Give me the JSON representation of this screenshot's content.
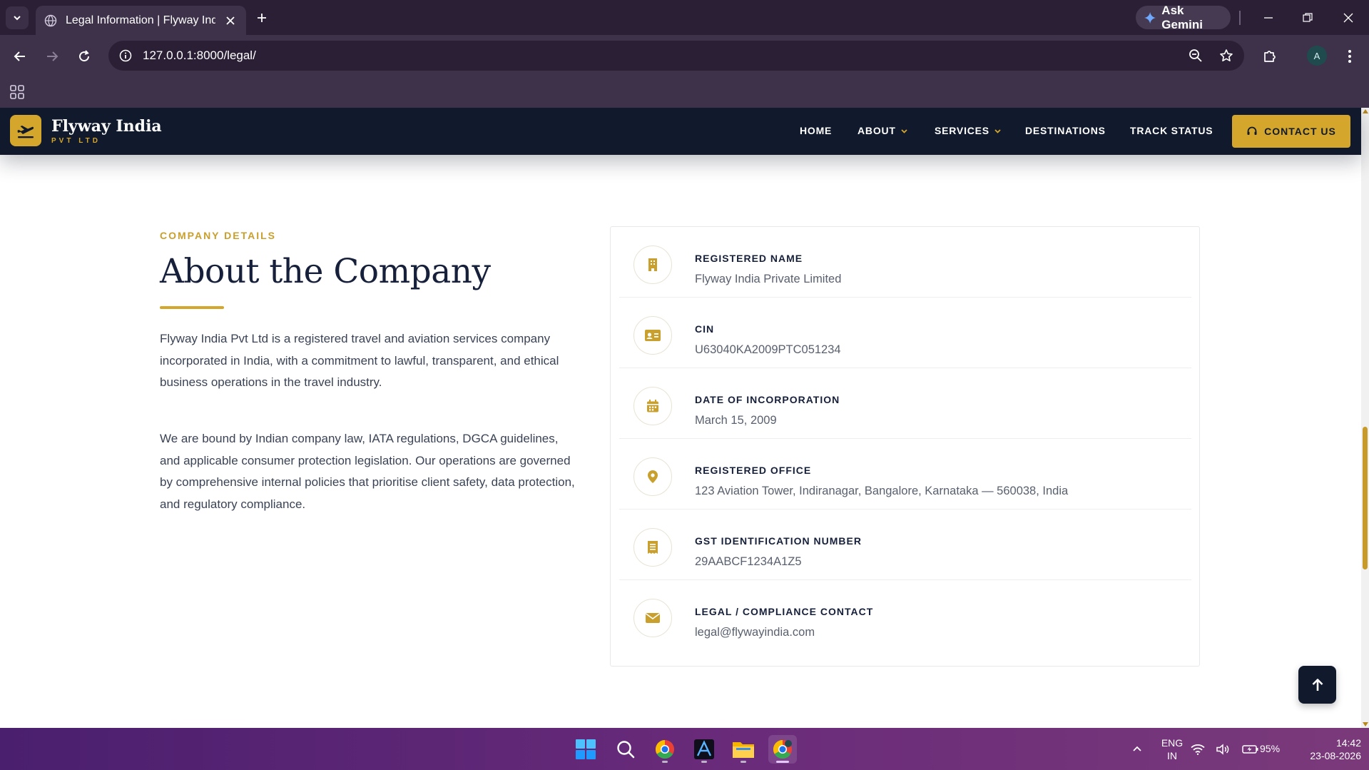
{
  "browser": {
    "tab_title": "Legal Information | Flyway India",
    "new_tab_label": "+",
    "gemini_label": "Ask Gemini",
    "url": "127.0.0.1:8000/legal/",
    "profile_initial": "A"
  },
  "site": {
    "logo_name": "Flyway India",
    "logo_sub": "PVT LTD",
    "nav": {
      "home": "HOME",
      "about": "ABOUT",
      "services": "SERVICES",
      "destinations": "DESTINATIONS",
      "track_status": "TRACK STATUS"
    },
    "contact_label": "CONTACT US"
  },
  "section": {
    "kicker": "COMPANY DETAILS",
    "heading": "About the Company",
    "paragraphs": [
      "Flyway India Pvt Ltd is a registered travel and aviation services company incorporated in India, with a commitment to lawful, transparent, and ethical business operations in the travel industry.",
      "We are bound by Indian company law, IATA regulations, DGCA guidelines, and applicable consumer protection legislation. Our operations are governed by comprehensive internal policies that prioritise client safety, data protection, and regulatory compliance."
    ]
  },
  "details": [
    {
      "icon": "building-icon",
      "label": "REGISTERED NAME",
      "value": "Flyway India Private Limited"
    },
    {
      "icon": "id-card-icon",
      "label": "CIN",
      "value": "U63040KA2009PTC051234"
    },
    {
      "icon": "calendar-icon",
      "label": "DATE OF INCORPORATION",
      "value": "March 15, 2009"
    },
    {
      "icon": "map-pin-icon",
      "label": "REGISTERED OFFICE",
      "value": "123 Aviation Tower, Indiranagar, Bangalore, Karnataka — 560038, India"
    },
    {
      "icon": "receipt-icon",
      "label": "GST IDENTIFICATION NUMBER",
      "value": "29AABCF1234A1Z5"
    },
    {
      "icon": "envelope-icon",
      "label": "LEGAL / COMPLIANCE CONTACT",
      "value": "legal@flywayindia.com"
    }
  ],
  "taskbar": {
    "lang_top": "ENG",
    "lang_bottom": "IN",
    "battery": "95%",
    "time": "14:42",
    "date": "23-08-2026"
  },
  "colors": {
    "accent_gold": "#d4a72c",
    "navy": "#111a2c",
    "chrome": "#3d3249"
  }
}
